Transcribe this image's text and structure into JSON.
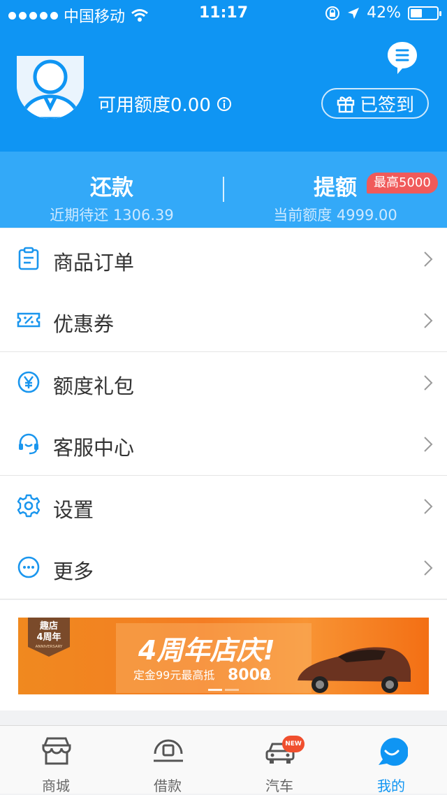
{
  "status_bar": {
    "carrier": "中国移动",
    "time": "11:17",
    "battery": "42%"
  },
  "profile": {
    "credit_label": "可用额度0.00",
    "sign_button": "已签到"
  },
  "summary": {
    "repay_title": "还款",
    "repay_sub": "近期待还 1306.39",
    "raise_title": "提额",
    "raise_sub": "当前额度 4999.00",
    "raise_badge": "最高5000"
  },
  "menu": {
    "items": [
      {
        "label": "商品订单",
        "icon": "clipboard-icon"
      },
      {
        "label": "优惠券",
        "icon": "ticket-icon"
      },
      {
        "label": "额度礼包",
        "icon": "yen-coin-icon"
      },
      {
        "label": "客服中心",
        "icon": "headset-icon"
      },
      {
        "label": "设置",
        "icon": "gear-icon"
      },
      {
        "label": "更多",
        "icon": "more-icon"
      }
    ]
  },
  "banner": {
    "logo_line1": "趣店",
    "logo_line2": "4周年",
    "logo_line3": "ANNIVERSARY",
    "headline": "4周年店庆!",
    "sub_prefix": "定金99元最高抵",
    "sub_amount": "8000",
    "sub_suffix": "元"
  },
  "tabbar": {
    "tabs": [
      {
        "label": "商城"
      },
      {
        "label": "借款"
      },
      {
        "label": "汽车",
        "badge": "NEW"
      },
      {
        "label": "我的"
      }
    ]
  },
  "colors": {
    "brand": "#0f95f3",
    "bar": "#33a9f8",
    "badge": "#f05a5a"
  }
}
